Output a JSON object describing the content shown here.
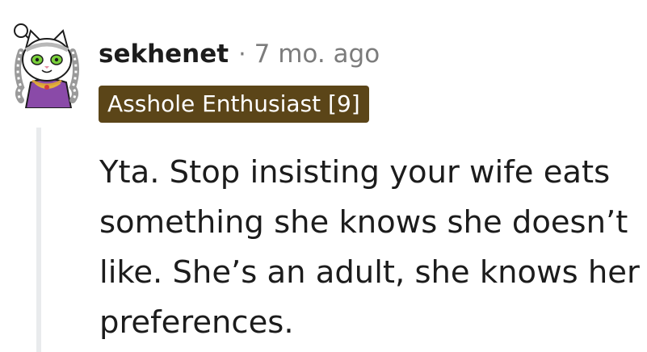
{
  "comment": {
    "username": "sekhenet",
    "separator": "·",
    "timestamp": "7 mo. ago",
    "flair": "Asshole Enthusiast [9]",
    "body": "Yta. Stop insisting your wife eats something she knows she doesn’t like. She’s an adult, she knows her preferences."
  },
  "avatar": {
    "icon": "snoo-cat-avatar-icon"
  },
  "colors": {
    "flair_background": "#5b4518",
    "flair_text": "#ffffff",
    "username": "#1c1c1c",
    "meta": "#7c7c7c",
    "thread_line": "#e9ebed"
  }
}
